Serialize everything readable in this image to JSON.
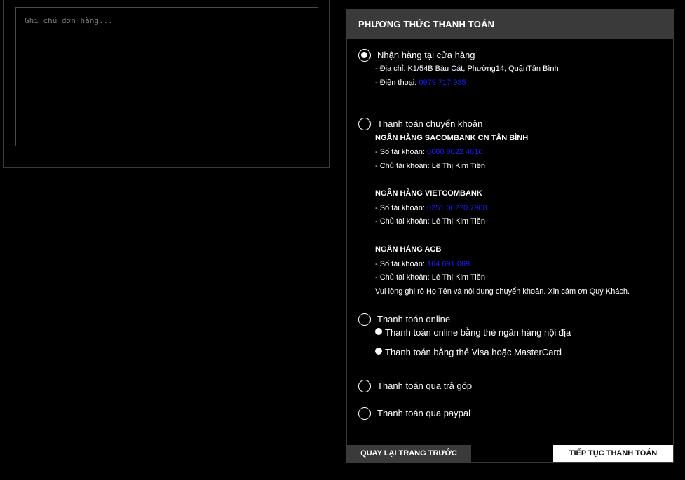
{
  "note": {
    "placeholder": "Ghi chú đơn hàng..."
  },
  "payment": {
    "title": "PHƯƠNG THỨC THANH TOÁN",
    "store": {
      "label": "Nhận hàng tại cửa hàng",
      "address": "- Địa chỉ: K1/54B Bàu Cát, Phường14, QuậnTân Bình",
      "phone_prefix": "- Điện thoại: ",
      "phone": "0979 717 935",
      "selected": true
    },
    "transfer": {
      "label": "Thanh toán chuyển khoản",
      "account_prefix": "- Số tài khoản: ",
      "holder_line": "- Chủ tài khoản: Lê Thị Kim Tiền",
      "banks": [
        {
          "name": "NGÂN HÀNG SACOMBANK CN TÂN BÌNH",
          "account": "0600 8022 4616"
        },
        {
          "name": "NGÂN HÀNG VIETCOMBANK",
          "account": "0251 00270 7908"
        },
        {
          "name": "NGÂN HÀNG ACB",
          "account": "164 691 069"
        }
      ],
      "note": "Vui lòng ghi rõ Họ Tên và nội dung chuyển khoản. Xin cảm ơn Quý Khách."
    },
    "online": {
      "label": "Thanh toán online",
      "options": [
        "Thanh toán online bằng thẻ ngân hàng nội địa",
        "Thanh toán bằng thẻ Visa hoặc MasterCard"
      ]
    },
    "installment": {
      "label": "Thanh toán qua trả góp"
    },
    "paypal": {
      "label": "Thanh toán qua paypal"
    }
  },
  "buttons": {
    "back": "QUAY LẠI TRANG TRƯỚC",
    "next": "TIẾP TỤC THANH TOÁN"
  }
}
